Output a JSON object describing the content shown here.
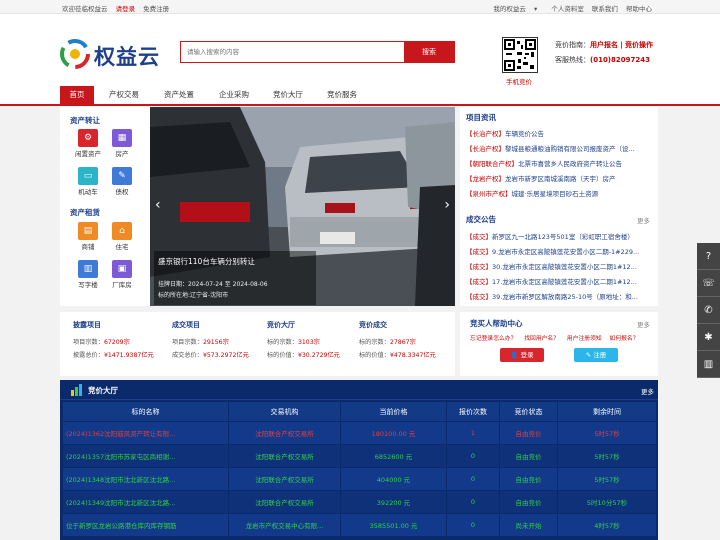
{
  "topbar": {
    "welcome": "欢迎莅临权益云",
    "login": "请登录",
    "register": "免费注册",
    "my": "我的权益云",
    "user_center": "个人资料室",
    "contact": "联系我们",
    "help": "帮助中心"
  },
  "header": {
    "logo_text": "权益云",
    "search_placeholder": "请输入搜索的内容",
    "search_button": "搜索",
    "qr_label": "手机竞价",
    "guide_label": "竞价指南：",
    "guide_link1": "用户报名",
    "guide_sep": "|",
    "guide_link2": "竞价操作",
    "hotline_label": "客服热线：",
    "hotline": "(010)82097243"
  },
  "nav": [
    "首页",
    "产权交易",
    "资产处置",
    "企业采购",
    "竞价大厅",
    "竞价服务"
  ],
  "left": {
    "section1": "资产转让",
    "section1_items": [
      {
        "label": "闲置资产",
        "icon": "gear-icon",
        "color": "#d9262c"
      },
      {
        "label": "房产",
        "icon": "building-icon",
        "color": "#7d5bd6"
      },
      {
        "label": "机动车",
        "icon": "car-icon",
        "color": "#2bb5c8"
      },
      {
        "label": "债权",
        "icon": "document-icon",
        "color": "#3f7ad8"
      }
    ],
    "section2": "资产租赁",
    "section2_items": [
      {
        "label": "商铺",
        "icon": "shop-icon",
        "color": "#f08a24"
      },
      {
        "label": "住宅",
        "icon": "house-icon",
        "color": "#f08a24"
      },
      {
        "label": "写字楼",
        "icon": "office-icon",
        "color": "#3f7ad8"
      },
      {
        "label": "厂库房",
        "icon": "warehouse-icon",
        "color": "#7d5bd6"
      }
    ]
  },
  "banner": {
    "title": "盛京银行110台车辆分别转让",
    "date_line": "挂牌日期：2024-07-24 至 2024-08-06",
    "location_line": "标的所在地:辽宁省-沈阳市"
  },
  "news": {
    "title": "项目资讯",
    "items": [
      {
        "tag": "【长治产权】",
        "text": "车辆竞价公告"
      },
      {
        "tag": "【长治产权】",
        "text": "黎城县粮通粮油购销有限公司报废资产（设..."
      },
      {
        "tag": "【朝阳联合产权】",
        "text": "北票市喜营乡人民政府资产转让公告"
      },
      {
        "tag": "【龙岩产权】",
        "text": "龙岩市新罗区南城溪南路（天宇）房产"
      },
      {
        "tag": "【泉州市产权】",
        "text": "城建·乐居星境项目砂石土资源"
      }
    ]
  },
  "deals": {
    "title": "成交公告",
    "more": "更多",
    "items": [
      {
        "tag": "【成交】",
        "text": "新罗区九一北路123号501室（彩虹职工宿舍楼）"
      },
      {
        "tag": "【成交】",
        "text": "9.龙岩市永定区高陂镇莲花安置小区二期-1#229..."
      },
      {
        "tag": "【成交】",
        "text": "30.龙岩市永定区高陂镇莲花安置小区二期1#12..."
      },
      {
        "tag": "【成交】",
        "text": "17.龙岩市永定区高陂镇莲花安置小区二期1#12..."
      },
      {
        "tag": "【成交】",
        "text": "39.龙岩市新罗区解放南路25-10号（原地址：和..."
      }
    ]
  },
  "stats": [
    {
      "title": "披露项目",
      "l1": "项目宗数：",
      "v1": "67209宗",
      "l2": "披露总价：",
      "v2": "¥1471.9387亿元"
    },
    {
      "title": "成交项目",
      "l1": "项目宗数：",
      "v1": "29156宗",
      "l2": "成交总价：",
      "v2": "¥573.2972亿元"
    },
    {
      "title": "竞价大厅",
      "l1": "标的宗数：",
      "v1": "3103宗",
      "l2": "标的价值：",
      "v2": "¥30.2729亿元"
    },
    {
      "title": "竞价成交",
      "l1": "标的宗数：",
      "v1": "27867宗",
      "l2": "标的价值：",
      "v2": "¥478.3347亿元"
    }
  ],
  "help": {
    "title": "竞买人帮助中心",
    "more": "更多",
    "links": [
      "忘记登录怎么办？",
      "找回用户名？",
      "用户注册须知",
      "如何报名？"
    ],
    "login_button": "登录",
    "register_button": "注册"
  },
  "auction": {
    "title": "竞价大厅",
    "more": "更多",
    "headers": [
      "标的名称",
      "交易机构",
      "当前价格",
      "报价次数",
      "竞价状态",
      "剩余时间"
    ],
    "rows": [
      {
        "name": "(2024)1362沈阳鼓风资产转让有限...",
        "org": "沈阳联合产权交易所",
        "price": "180100.00 元",
        "count": "1",
        "status": "自由竞价",
        "remain": "5时57秒",
        "highlight": true
      },
      {
        "name": "(2024)1357沈阳市苏家屯区商相谢...",
        "org": "沈阳联合产权交易所",
        "price": "6852600 元",
        "count": "0",
        "status": "自由竞价",
        "remain": "5时57秒",
        "highlight": false
      },
      {
        "name": "(2024)1348沈阳市沈北新区沈北路...",
        "org": "沈阳联合产权交易所",
        "price": "404000 元",
        "count": "0",
        "status": "自由竞价",
        "remain": "5时57秒",
        "highlight": false
      },
      {
        "name": "(2024)1349沈阳市沈北新区沈北路...",
        "org": "沈阳联合产权交易所",
        "price": "392200 元",
        "count": "0",
        "status": "自由竞价",
        "remain": "5时10分57秒",
        "highlight": false
      },
      {
        "name": "位于新罗区龙岩公路港仓库内库存钢筋",
        "org": "龙岩市产权交易中心有限...",
        "price": "3585501.00 元",
        "count": "0",
        "status": "尚未开始",
        "remain": "4时57秒",
        "highlight": false
      }
    ]
  },
  "colors": {
    "brand_red": "#c8161d",
    "navy": "#1e3f8a",
    "green": "#2fd14a"
  }
}
